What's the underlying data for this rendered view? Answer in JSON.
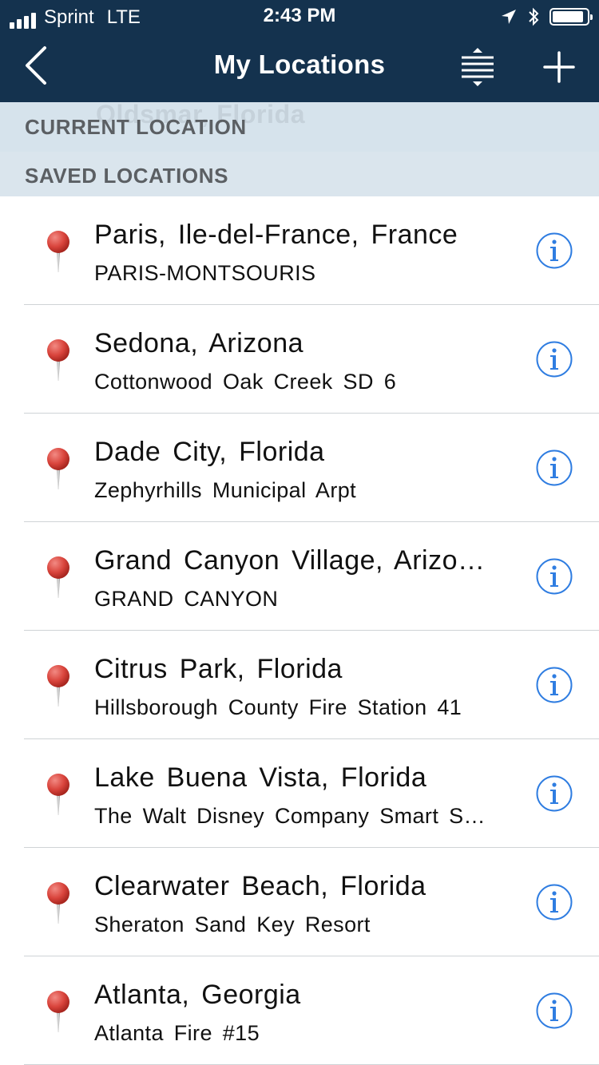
{
  "status_bar": {
    "carrier": "Sprint",
    "network": "LTE",
    "time": "2:43 PM",
    "icons": [
      "signal-bars-icon",
      "location-arrow-icon",
      "bluetooth-icon",
      "battery-icon"
    ]
  },
  "nav": {
    "title": "My Locations",
    "back_icon": "chevron-left-icon",
    "sort_icon": "sort-icon",
    "add_icon": "plus-icon"
  },
  "sections": {
    "current": "CURRENT LOCATION",
    "current_ghost": "Oldsmar, Florida",
    "saved": "SAVED LOCATIONS"
  },
  "colors": {
    "nav_background": "#14324e",
    "section_background": "#d6e3ec",
    "info_icon": "#2f7de1",
    "pin": "#d9443c"
  },
  "saved_locations": [
    {
      "title": "Paris, Ile-del-France, France",
      "subtitle": "PARIS-MONTSOURIS"
    },
    {
      "title": "Sedona, Arizona",
      "subtitle": "Cottonwood Oak Creek SD 6"
    },
    {
      "title": "Dade City, Florida",
      "subtitle": "Zephyrhills Municipal Arpt"
    },
    {
      "title": "Grand Canyon Village, Arizona",
      "subtitle": "GRAND CANYON"
    },
    {
      "title": "Citrus Park, Florida",
      "subtitle": "Hillsborough County Fire Station 41"
    },
    {
      "title": "Lake Buena Vista, Florida",
      "subtitle": "The Walt Disney Company Smart Station"
    },
    {
      "title": "Clearwater Beach, Florida",
      "subtitle": "Sheraton Sand Key Resort"
    },
    {
      "title": "Atlanta, Georgia",
      "subtitle": "Atlanta Fire #15"
    }
  ]
}
